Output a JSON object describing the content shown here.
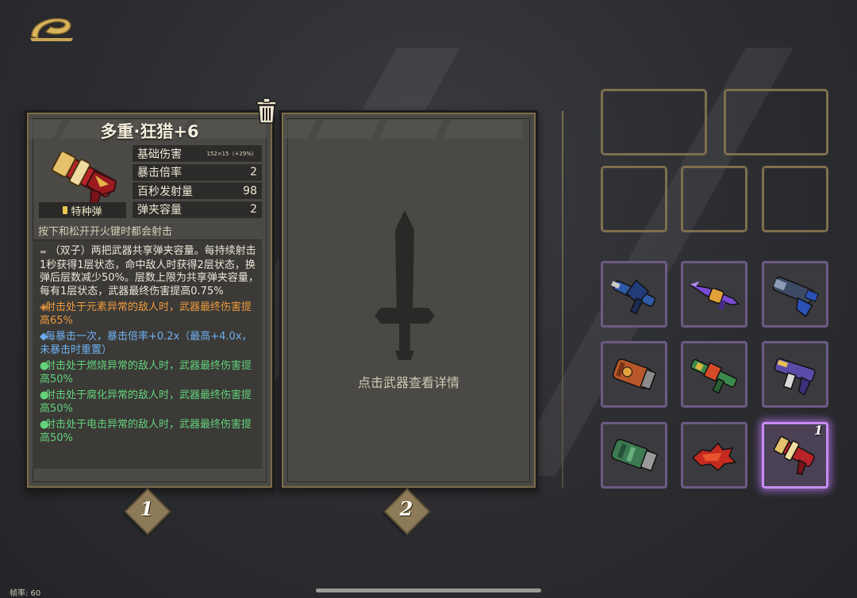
{
  "detail": {
    "title": "多重·狂猎+6",
    "ammo_type": "特种弹",
    "stats": [
      {
        "label": "基础伤害",
        "value": "152×15（+29%）"
      },
      {
        "label": "暴击倍率",
        "value": "2"
      },
      {
        "label": "百秒发射量",
        "value": "98"
      },
      {
        "label": "弹夹容量",
        "value": "2"
      }
    ],
    "fire_note": "按下和松开开火键时都会射击",
    "desc_main": "（双子）两把武器共享弹夹容量。每持续射击1秒获得1层状态，命中敌人时获得2层状态，换弹后层数减少50%。层数上限为共享弹夹容量，每有1层状态，武器最终伤害提高0.75%",
    "perks": [
      {
        "marker": "◈",
        "text": "射击处于元素异常的敌人时，武器最终伤害提高65%",
        "color": "orange"
      },
      {
        "marker": "◆",
        "text": "每暴击一次，暴击倍率+0.2x（最高+4.0x，未暴击时重置）",
        "color": "blue"
      },
      {
        "marker": "●",
        "text": "射击处于燃烧异常的敌人时，武器最终伤害提高50%",
        "color": "green"
      },
      {
        "marker": "●",
        "text": "射击处于腐化异常的敌人时，武器最终伤害提高50%",
        "color": "green"
      },
      {
        "marker": "●",
        "text": "射击处于电击异常的敌人时，武器最终伤害提高50%",
        "color": "green"
      }
    ]
  },
  "empty_slot": {
    "hint": "点击武器查看详情"
  },
  "weapon_slots": [
    "1",
    "2"
  ],
  "inventory": {
    "items": [
      {
        "icon": "blue-crossbow-gun-icon"
      },
      {
        "icon": "purple-spear-gun-icon"
      },
      {
        "icon": "blue-heavy-gun-icon"
      },
      {
        "icon": "orange-gauntlet-icon"
      },
      {
        "icon": "green-rifle-icon"
      },
      {
        "icon": "purple-smg-icon"
      },
      {
        "icon": "green-gauntlet-icon"
      },
      {
        "icon": "red-dragon-gun-icon"
      },
      {
        "icon": "gold-red-multi-barrel-gun-icon",
        "badge": "1",
        "selected": true
      }
    ]
  },
  "status": {
    "fps": "帧率: 60"
  },
  "colors": {
    "accent_gold": "#7e6f4e",
    "slot_purple": "#6b5a86",
    "selected_glow": "#c78cf2",
    "perk_orange": "#f09a3e",
    "perk_blue": "#6fb0f2",
    "perk_green": "#63d37b"
  }
}
